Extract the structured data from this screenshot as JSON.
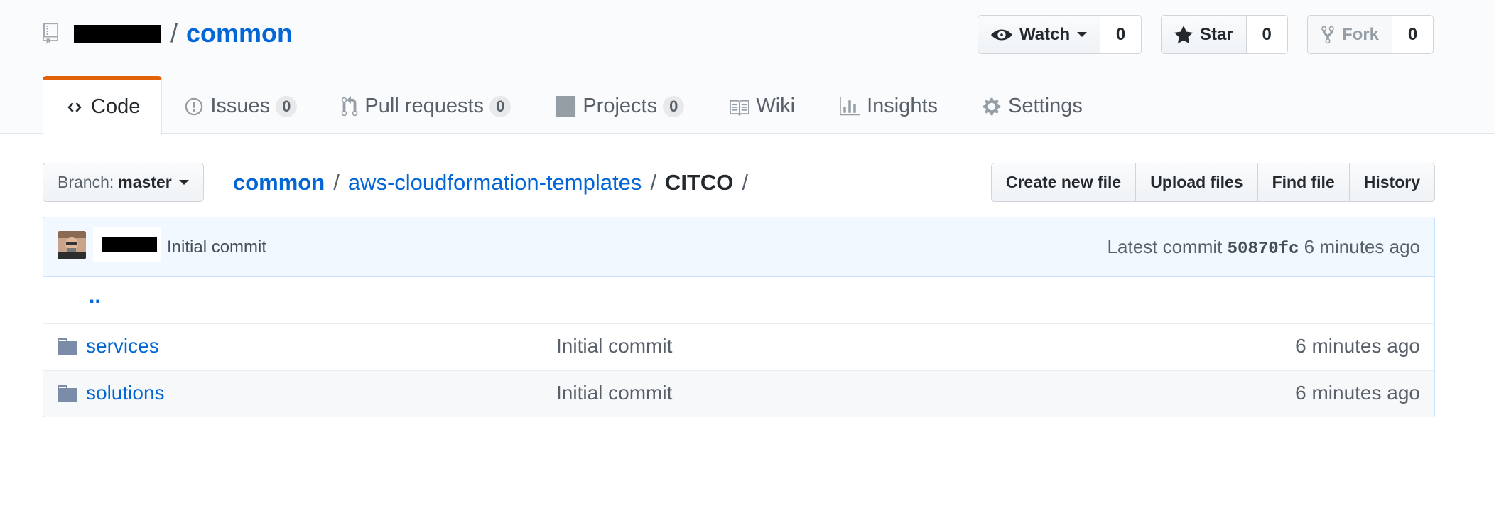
{
  "repo": {
    "name": "common"
  },
  "actions": {
    "watch": {
      "label": "Watch",
      "count": "0"
    },
    "star": {
      "label": "Star",
      "count": "0"
    },
    "fork": {
      "label": "Fork",
      "count": "0"
    }
  },
  "nav": {
    "tabs": [
      {
        "label": "Code",
        "icon": "code-icon",
        "count": null,
        "selected": true
      },
      {
        "label": "Issues",
        "icon": "issue-icon",
        "count": "0"
      },
      {
        "label": "Pull requests",
        "icon": "pull-request-icon",
        "count": "0"
      },
      {
        "label": "Projects",
        "icon": "project-icon",
        "count": "0"
      },
      {
        "label": "Wiki",
        "icon": "book-icon",
        "count": null
      },
      {
        "label": "Insights",
        "icon": "graph-icon",
        "count": null
      },
      {
        "label": "Settings",
        "icon": "gear-icon",
        "count": null
      }
    ]
  },
  "file_nav": {
    "branch_prefix": "Branch:",
    "branch": "master",
    "path": [
      "common",
      "aws-cloudformation-templates",
      "CITCO"
    ],
    "buttons": [
      "Create new file",
      "Upload files",
      "Find file",
      "History"
    ]
  },
  "commit": {
    "message": "Initial commit",
    "latest_label": "Latest commit",
    "sha": "50870fc",
    "age": "6 minutes ago"
  },
  "files": {
    "parent": "..",
    "entries": [
      {
        "name": "services",
        "type": "folder",
        "message": "Initial commit",
        "age": "6 minutes ago"
      },
      {
        "name": "solutions",
        "type": "folder",
        "message": "Initial commit",
        "age": "6 minutes ago"
      }
    ]
  },
  "colors": {
    "link": "#0366d6",
    "selected_tab_accent": "#e36209",
    "commit_bg": "#f1f8ff"
  }
}
